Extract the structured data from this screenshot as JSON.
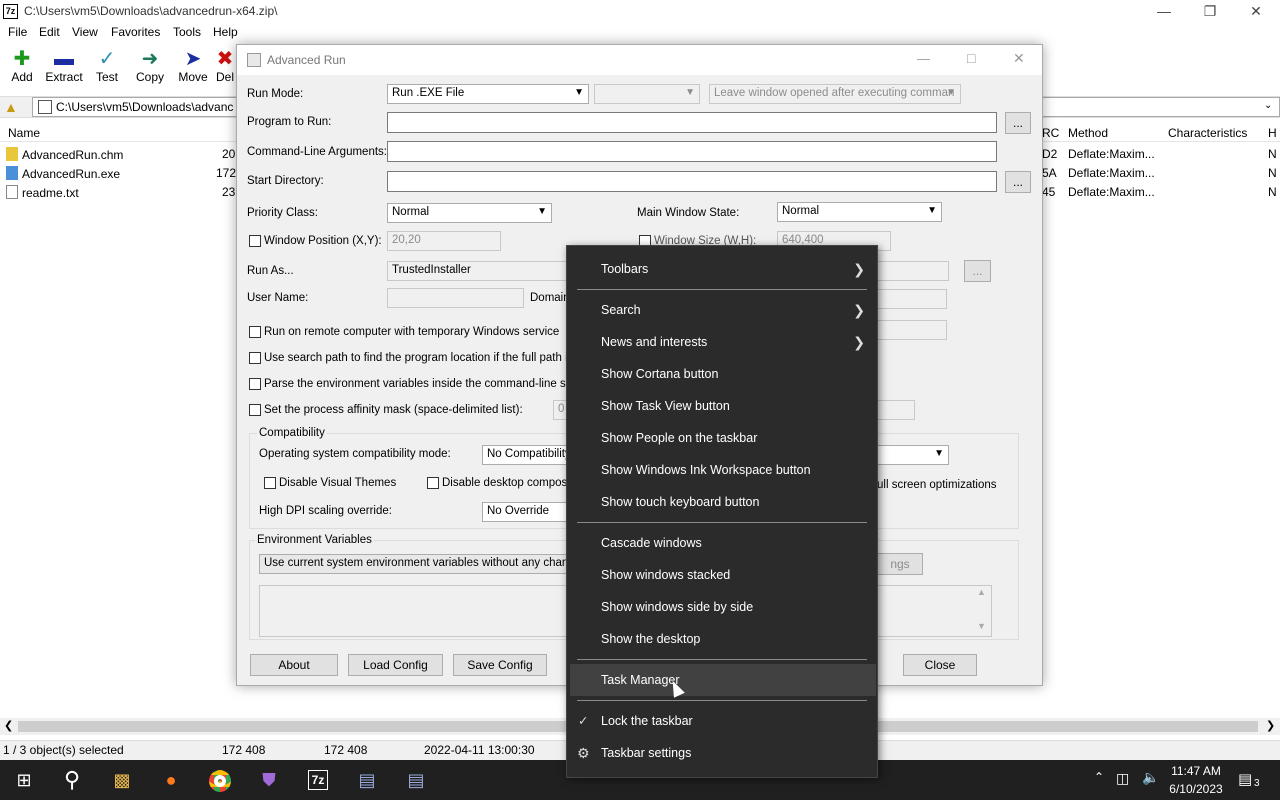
{
  "zip": {
    "title": "C:\\Users\\vm5\\Downloads\\advancedrun-x64.zip\\",
    "icon_text": "7z",
    "menu": [
      "File",
      "Edit",
      "View",
      "Favorites",
      "Tools",
      "Help"
    ],
    "toolbar": [
      {
        "label": "Add",
        "icon": "plus-icon",
        "color": "#1a9a1a"
      },
      {
        "label": "Extract",
        "icon": "minus-icon",
        "color": "#1a2ea0"
      },
      {
        "label": "Test",
        "icon": "check-icon",
        "color": "#2a8fb0"
      },
      {
        "label": "Copy",
        "icon": "copy-arrow-icon",
        "color": "#1a7a5a"
      },
      {
        "label": "Move",
        "icon": "move-arrow-icon",
        "color": "#1a2ea0"
      },
      {
        "label": "Del",
        "icon": "delete-x-icon",
        "color": "#cc1010"
      }
    ],
    "address": "C:\\Users\\vm5\\Downloads\\advanc",
    "columns": {
      "name": "Name",
      "crc": "RC",
      "method": "Method",
      "characteristics": "Characteristics",
      "h": "H"
    },
    "files": [
      {
        "name": "AdvancedRun.chm",
        "size": "20",
        "crc": "D2",
        "method": "Deflate:Maxim...",
        "extra": "N"
      },
      {
        "name": "AdvancedRun.exe",
        "size": "172",
        "crc": "5A",
        "method": "Deflate:Maxim...",
        "extra": "N"
      },
      {
        "name": "readme.txt",
        "size": "23",
        "crc": "45",
        "method": "Deflate:Maxim...",
        "extra": "N"
      }
    ],
    "status": {
      "selected": "1 / 3 object(s) selected",
      "size1": "172 408",
      "size2": "172 408",
      "date": "2022-04-11 13:00:30"
    }
  },
  "advrun": {
    "title": "Advanced Run",
    "run_mode_label": "Run Mode:",
    "run_mode_value": "Run .EXE File",
    "leave_window": "Leave window opened after executing comman",
    "program_label": "Program to Run:",
    "args_label": "Command-Line Arguments:",
    "startdir_label": "Start Directory:",
    "browse": "...",
    "priority_label": "Priority Class:",
    "priority_value": "Normal",
    "main_window_label": "Main Window State:",
    "main_window_value": "Normal",
    "window_pos_label": "Window Position (X,Y):",
    "window_pos_value": "20,20",
    "window_size_label": "Window Size (W,H):",
    "window_size_value": "640,400",
    "run_as_label": "Run As...",
    "run_as_value": "TrustedInstaller",
    "user_name_label": "User Name:",
    "domain_label": "Domain",
    "remote_label": "Run on remote computer with temporary Windows service",
    "search_path_label": "Use search path to find the program location if the full path is n",
    "parse_env_label": "Parse the environment variables inside the command-line string",
    "affinity_label": "Set the process affinity mask (space-delimited list):",
    "affinity_value": "0",
    "compat_group": "Compatibility",
    "os_compat_label": "Operating system compatibility mode:",
    "os_compat_value": "No Compatibility",
    "disable_themes_label": "Disable Visual Themes",
    "disable_desktop_label": "Disable desktop compositio",
    "fullscreen_label": "ull screen optimizations",
    "dpi_label": "High DPI scaling override:",
    "dpi_value": "No Override",
    "env_group": "Environment Variables",
    "env_value": "Use current system environment variables without any change",
    "env_settings_btn": "ngs",
    "about_btn": "About",
    "load_btn": "Load Config",
    "save_btn": "Save Config",
    "close_btn": "Close"
  },
  "context_menu": {
    "items_a": [
      {
        "label": "Toolbars",
        "submenu": true
      }
    ],
    "items_b": [
      {
        "label": "Search",
        "submenu": true
      },
      {
        "label": "News and interests",
        "submenu": true
      },
      {
        "label": "Show Cortana button",
        "submenu": false
      },
      {
        "label": "Show Task View button",
        "submenu": false
      },
      {
        "label": "Show People on the taskbar",
        "submenu": false
      },
      {
        "label": "Show Windows Ink Workspace button",
        "submenu": false
      },
      {
        "label": "Show touch keyboard button",
        "submenu": false
      }
    ],
    "items_c": [
      {
        "label": "Cascade windows"
      },
      {
        "label": "Show windows stacked"
      },
      {
        "label": "Show windows side by side"
      },
      {
        "label": "Show the desktop"
      }
    ],
    "task_manager": "Task Manager",
    "lock_taskbar": "Lock the taskbar",
    "taskbar_settings": "Taskbar settings"
  },
  "taskbar": {
    "time": "11:47 AM",
    "date": "6/10/2023",
    "notification_count": "3",
    "apps": [
      "start-icon",
      "search-icon",
      "file-explorer-icon",
      "firefox-icon",
      "chrome-icon",
      "app-icon",
      "7zip-icon",
      "notepad-icon",
      "notepad-icon"
    ]
  }
}
